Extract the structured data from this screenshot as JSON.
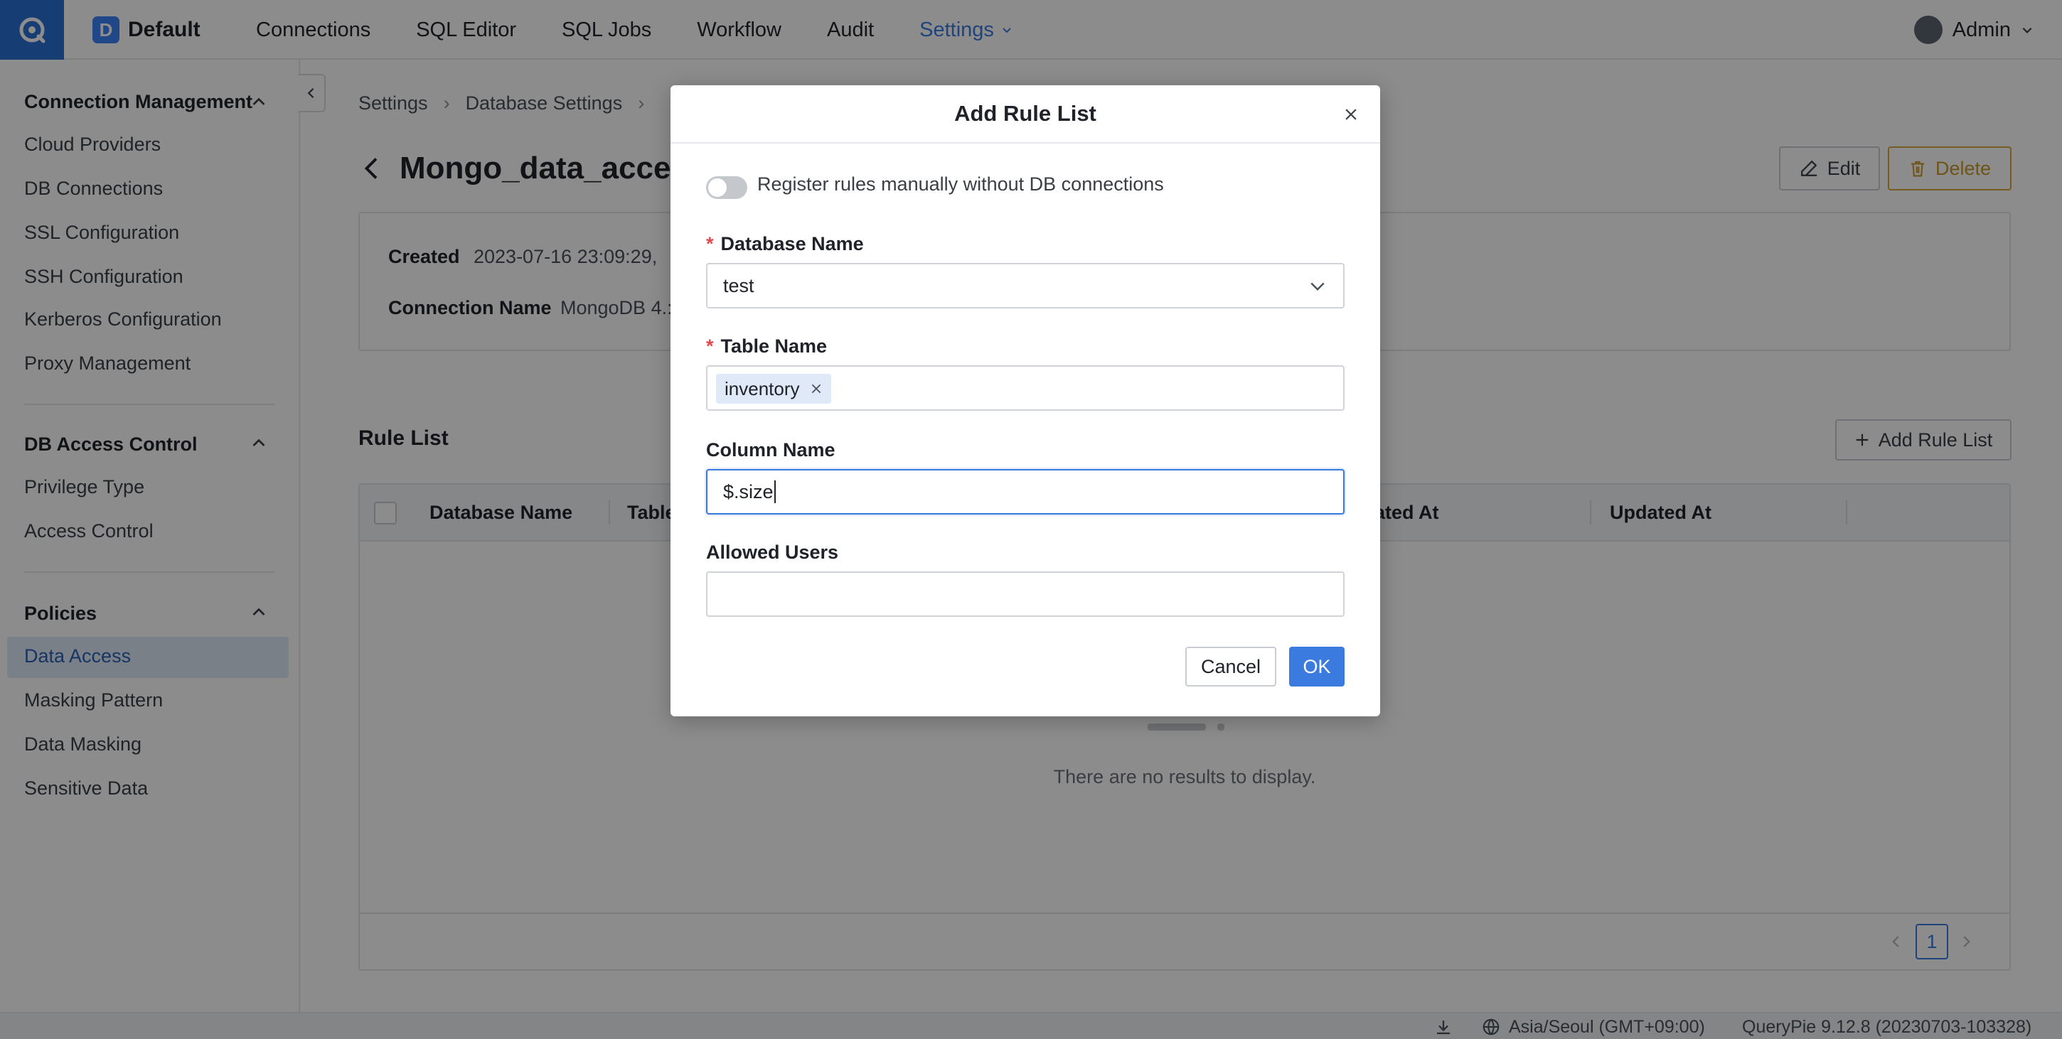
{
  "topbar": {
    "workspace_initial": "D",
    "workspace_name": "Default",
    "nav": [
      "Connections",
      "SQL Editor",
      "SQL Jobs",
      "Workflow",
      "Audit",
      "Settings"
    ],
    "active_nav": "Settings",
    "user_name": "Admin"
  },
  "sidebar": {
    "sections": [
      {
        "title": "Connection Management",
        "items": [
          "Cloud Providers",
          "DB Connections",
          "SSL Configuration",
          "SSH Configuration",
          "Kerberos Configuration",
          "Proxy Management"
        ]
      },
      {
        "title": "DB Access Control",
        "items": [
          "Privilege Type",
          "Access Control"
        ]
      },
      {
        "title": "Policies",
        "items": [
          "Data Access",
          "Masking Pattern",
          "Data Masking",
          "Sensitive Data"
        ]
      }
    ],
    "active_item": "Data Access"
  },
  "breadcrumb": [
    "Settings",
    "Database Settings"
  ],
  "page": {
    "title": "Mongo_data_access",
    "edit_label": "Edit",
    "delete_label": "Delete"
  },
  "info": {
    "created_label": "Created",
    "created_value": "2023-07-16 23:09:29,",
    "connection_label": "Connection Name",
    "connection_value": "MongoDB 4.:"
  },
  "rules": {
    "title": "Rule List",
    "add_label": "Add Rule List",
    "columns": [
      "Database Name",
      "Table",
      "eated At",
      "Updated At"
    ],
    "empty_text": "There are no results to display.",
    "page": "1"
  },
  "status": {
    "timezone": "Asia/Seoul (GMT+09:00)",
    "version": "QueryPie 9.12.8 (20230703-103328)"
  },
  "modal": {
    "title": "Add Rule List",
    "toggle_label": "Register rules manually without DB connections",
    "db_label": "Database Name",
    "db_value": "test",
    "table_label": "Table Name",
    "table_tag": "inventory",
    "column_label": "Column Name",
    "column_value": "$.size",
    "users_label": "Allowed Users",
    "users_value": "",
    "cancel_label": "Cancel",
    "ok_label": "OK"
  },
  "colors": {
    "accent": "#3b7be0",
    "delete": "#c99a2e",
    "required": "#e5484d"
  }
}
